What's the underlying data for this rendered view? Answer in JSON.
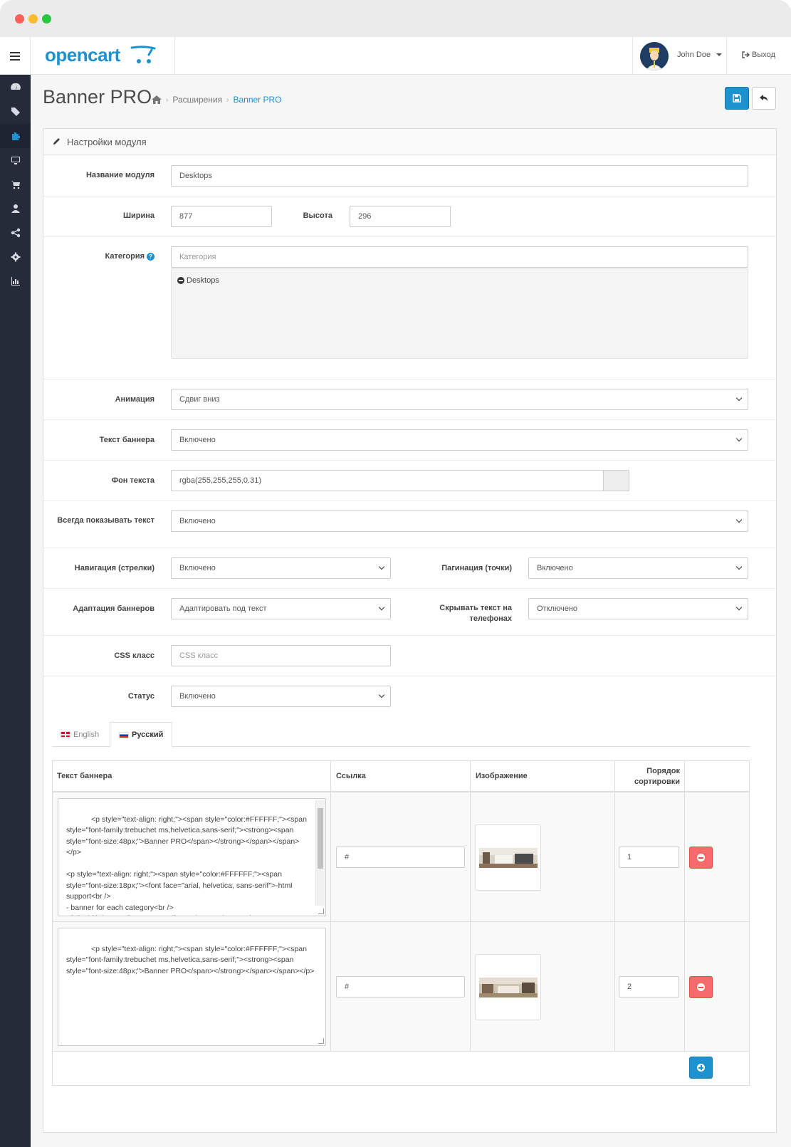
{
  "app": {
    "logo_text": "opencart",
    "user_name": "John Doe",
    "logout_label": "Выход"
  },
  "header": {
    "page_title": "Banner PRO",
    "breadcrumbs": [
      "Расширения",
      "Banner PRO"
    ]
  },
  "panel": {
    "title": "Настройки модуля"
  },
  "form": {
    "module_name": {
      "label": "Название модуля",
      "value": "Desktops"
    },
    "width": {
      "label": "Ширина",
      "value": "877"
    },
    "height": {
      "label": "Высота",
      "value": "296"
    },
    "category": {
      "label": "Категория",
      "placeholder": "Категория",
      "selected": [
        "Desktops"
      ]
    },
    "animation": {
      "label": "Анимация",
      "value": "Сдвиг вниз"
    },
    "banner_text": {
      "label": "Текст баннера",
      "value": "Включено"
    },
    "text_bg": {
      "label": "Фон текста",
      "value": "rgba(255,255,255,0.31)"
    },
    "always_show_text": {
      "label": "Всегда показывать текст",
      "value": "Включено"
    },
    "navigation": {
      "label": "Навигация (стрелки)",
      "value": "Включено"
    },
    "pagination": {
      "label": "Пагинация (точки)",
      "value": "Включено"
    },
    "adaptation": {
      "label": "Адаптация баннеров",
      "value": "Адаптировать под текст"
    },
    "hide_text_phones": {
      "label": "Скрывать текст на телефонах",
      "value": "Отключено"
    },
    "css_class": {
      "label": "CSS класс",
      "placeholder": "CSS класс"
    },
    "status": {
      "label": "Статус",
      "value": "Включено"
    }
  },
  "tabs": [
    {
      "label": "English",
      "active": false
    },
    {
      "label": "Русский",
      "active": true
    }
  ],
  "table": {
    "headers": [
      "Текст баннера",
      "Ссылка",
      "Изображение",
      "Порядок сортировки"
    ],
    "rows": [
      {
        "text": "<p style=\"text-align: right;\"><span style=\"color:#FFFFFF;\"><span style=\"font-family:trebuchet ms,helvetica,sans-serif;\"><strong><span style=\"font-size:48px;\">Banner PRO</span></strong></span></span></p>\n\n<p style=\"text-align: right;\"><span style=\"color:#FFFFFF;\"><span style=\"font-size:18px;\"><font face=\"arial, helvetica, sans-serif\">-html support<br />\n- banner for each category<br />\n- full width banner for category</font></span></span></p>",
        "link": "#",
        "sort": "1"
      },
      {
        "text": "<p style=\"text-align: right;\"><span style=\"color:#FFFFFF;\"><span style=\"font-family:trebuchet ms,helvetica,sans-serif;\"><strong><span style=\"font-size:48px;\">Banner PRO</span></strong></span></span></p>",
        "link": "#",
        "sort": "2"
      }
    ]
  },
  "colors": {
    "brand": "#1e91cf",
    "sidebar": "#252b38",
    "danger": "#f56b6b"
  },
  "icons": [
    "menu-icon",
    "home-icon",
    "save-icon",
    "back-icon",
    "pencil-icon",
    "dashboard-icon",
    "tags-icon",
    "puzzle-icon",
    "desktop-icon",
    "cart-icon",
    "user-icon",
    "share-icon",
    "gear-icon",
    "chart-icon",
    "logout-icon",
    "help-icon"
  ]
}
